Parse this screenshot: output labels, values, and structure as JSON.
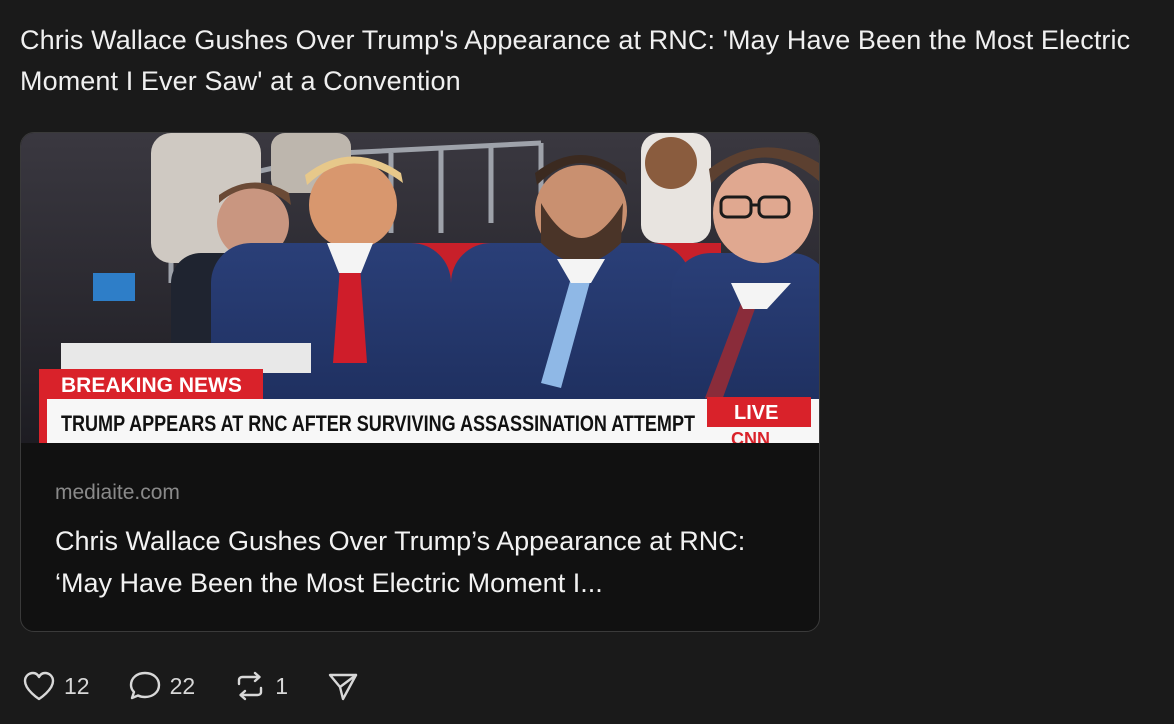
{
  "post": {
    "text": "Chris Wallace Gushes Over Trump's Appearance at RNC: 'May Have Been the Most Electric Moment I Ever Saw' at a Convention"
  },
  "link_card": {
    "image": {
      "chyron_label": "BREAKING NEWS",
      "chyron_headline": "TRUMP APPEARS AT RNC AFTER SURVIVING ASSASSINATION ATTEMPT",
      "live_badge": "LIVE",
      "network_logo": "CNN"
    },
    "domain": "mediaite.com",
    "title": "Chris Wallace Gushes Over Trump’s Appearance at RNC: ‘May Have Been the Most Electric Moment I..."
  },
  "actions": {
    "like": {
      "icon": "heart-icon",
      "count": "12"
    },
    "comment": {
      "icon": "comment-icon",
      "count": "22"
    },
    "restack": {
      "icon": "restack-icon",
      "count": "1"
    },
    "share": {
      "icon": "share-icon"
    }
  },
  "colors": {
    "background": "#1a1a1a",
    "card_background": "#111111",
    "chyron_red": "#d9222a"
  }
}
